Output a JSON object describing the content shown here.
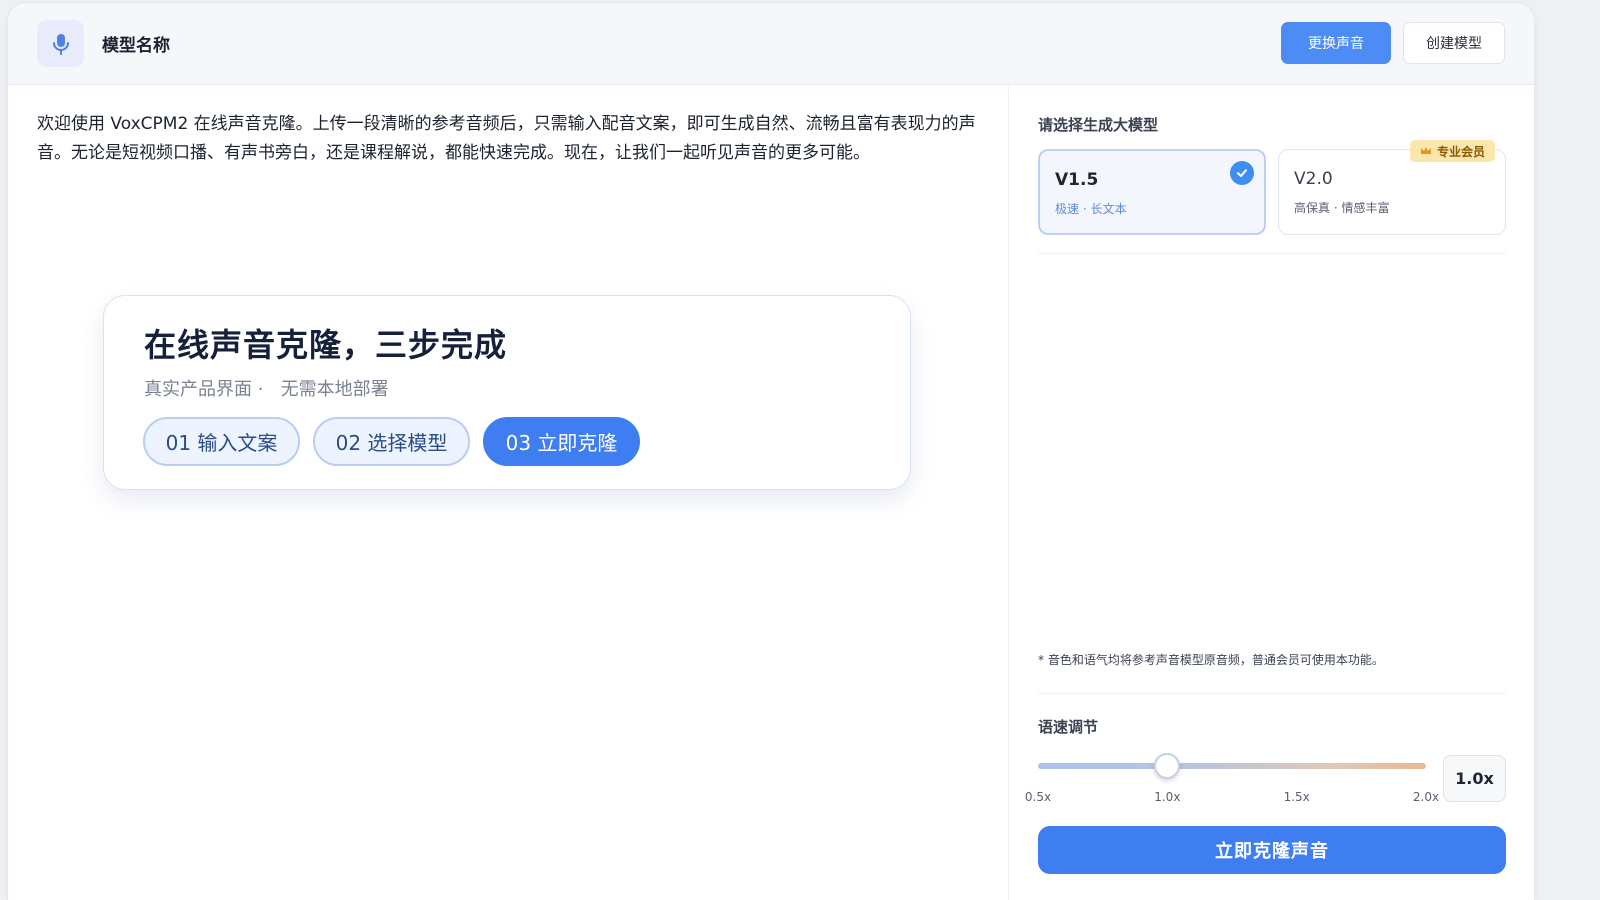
{
  "header": {
    "model_title": "模型名称",
    "change_voice_label": "更换声音",
    "create_model_label": "创建模型",
    "mic_icon": "microphone-icon"
  },
  "intro": {
    "text": "欢迎使用 VoxCPM2 在线声音克隆。上传一段清晰的参考音频后，只需输入配音文案，即可生成自然、流畅且富有表现力的声音。无论是短视频口播、有声书旁白，还是课程解说，都能快速完成。现在，让我们一起听见声音的更多可能。"
  },
  "steps_card": {
    "title": "在线声音克隆，三步完成",
    "subtitle": "真实产品界面 ·   无需本地部署",
    "steps": [
      {
        "label": "01 输入文案",
        "active": false
      },
      {
        "label": "02 选择模型",
        "active": false
      },
      {
        "label": "03 立即克隆",
        "active": true
      }
    ]
  },
  "model_select": {
    "label": "请选择生成大模型",
    "models": [
      {
        "name": "V1.5",
        "tags": "极速 · 长文本",
        "selected": true
      },
      {
        "name": "V2.0",
        "tags": "高保真 · 情感丰富",
        "selected": false,
        "badge": "专业会员"
      }
    ]
  },
  "note": "* 音色和语气均将参考声音模型原音频，普通会员可使用本功能。",
  "speed": {
    "label": "语速调节",
    "ticks": [
      "0.5x",
      "1.0x",
      "1.5x",
      "2.0x"
    ],
    "min": 0.5,
    "max": 2.0,
    "value": 1.0,
    "value_label": "1.0x"
  },
  "clone_button_label": "立即克隆声音",
  "colors": {
    "primary": "#3f7ef0",
    "badge_bg": "#fbe7ad"
  }
}
